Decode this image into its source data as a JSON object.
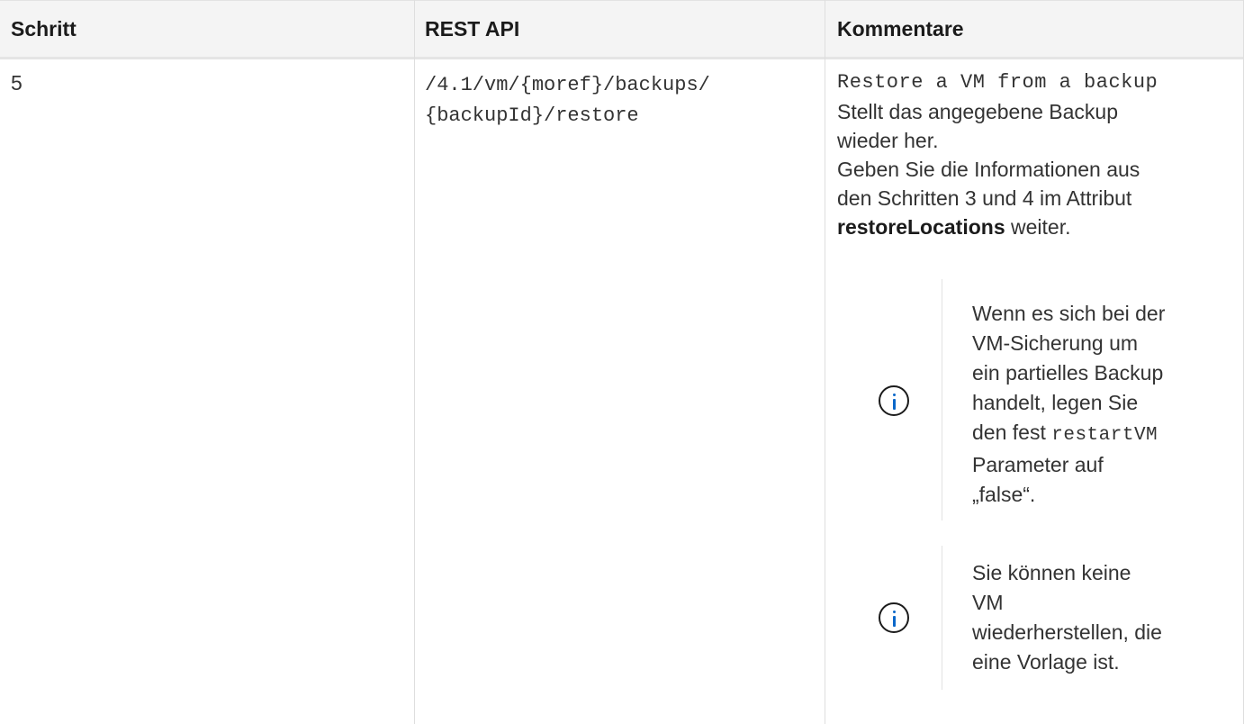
{
  "table": {
    "headers": {
      "step": "Schritt",
      "api": "REST API",
      "comments": "Kommentare"
    },
    "row": {
      "step": "5",
      "api_line1": "/4.1/vm/{moref}/backups/",
      "api_line2": "{backupId}/restore",
      "comment_summary": "Restore a VM from a backup",
      "comment_line1": "Stellt das angegebene Backup",
      "comment_line2": "wieder her.",
      "comment_line3": "Geben Sie die Informationen aus",
      "comment_line4": "den Schritten 3 und 4 im Attribut",
      "comment_bold": "restoreLocations",
      "comment_line5_tail": " weiter.",
      "notes": [
        {
          "icon": "info-icon",
          "line1": "Wenn es sich bei der",
          "line2": "VM-Sicherung um",
          "line3": "ein partielles Backup",
          "line4": "handelt, legen Sie",
          "line5_prefix": "den fest ",
          "line5_code": "restartVM",
          "line6": "Parameter auf",
          "line7": "„false“."
        },
        {
          "icon": "info-icon",
          "line1": "Sie können keine",
          "line2": "VM",
          "line3": "wiederherstellen, die",
          "line4": "eine Vorlage ist."
        }
      ]
    }
  },
  "colors": {
    "header_bg": "#f4f4f4",
    "text": "#333333",
    "icon_accent": "#0a67c9",
    "border": "#dedede"
  }
}
